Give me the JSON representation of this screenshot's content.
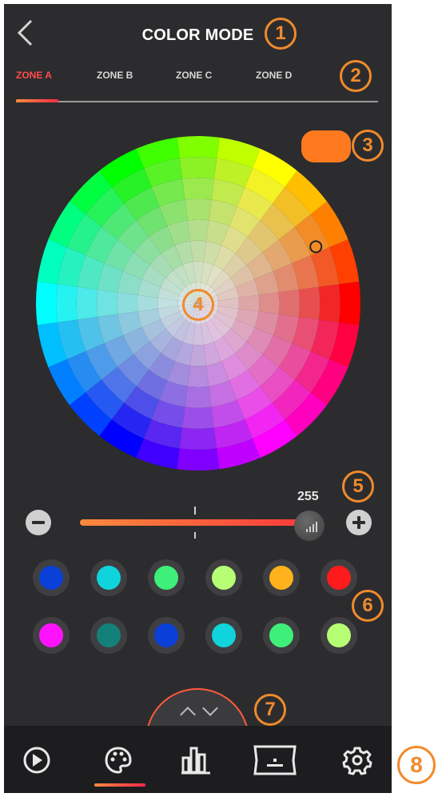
{
  "header": {
    "back": "back",
    "title": "COLOR MODE"
  },
  "tabs": [
    {
      "label": "ZONE A",
      "active": true
    },
    {
      "label": "ZONE B",
      "active": false
    },
    {
      "label": "ZONE C",
      "active": false
    },
    {
      "label": "ZONE D",
      "active": false
    }
  ],
  "current_color": "#ff7a1f",
  "color_wheel": {
    "rings": 8,
    "segments": 24,
    "selected_hue_deg": 25
  },
  "brightness": {
    "value": "255",
    "level_fraction": 1.0
  },
  "presets": [
    "#0a3fd8",
    "#10d4dc",
    "#3ef07a",
    "#b6ff75",
    "#ffb21c",
    "#ff1b1b",
    "#ff13ff",
    "#13807a",
    "#0a3fd8",
    "#10d4dc",
    "#3ef07a",
    "#b6ff75"
  ],
  "nav": {
    "items": [
      "play-icon",
      "palette-icon",
      "equalizer-icon",
      "display-icon",
      "gear-icon"
    ],
    "active_index": 1
  },
  "callouts": [
    "1",
    "2",
    "3",
    "4",
    "5",
    "6",
    "7",
    "8"
  ],
  "accent": "#f08a2c"
}
